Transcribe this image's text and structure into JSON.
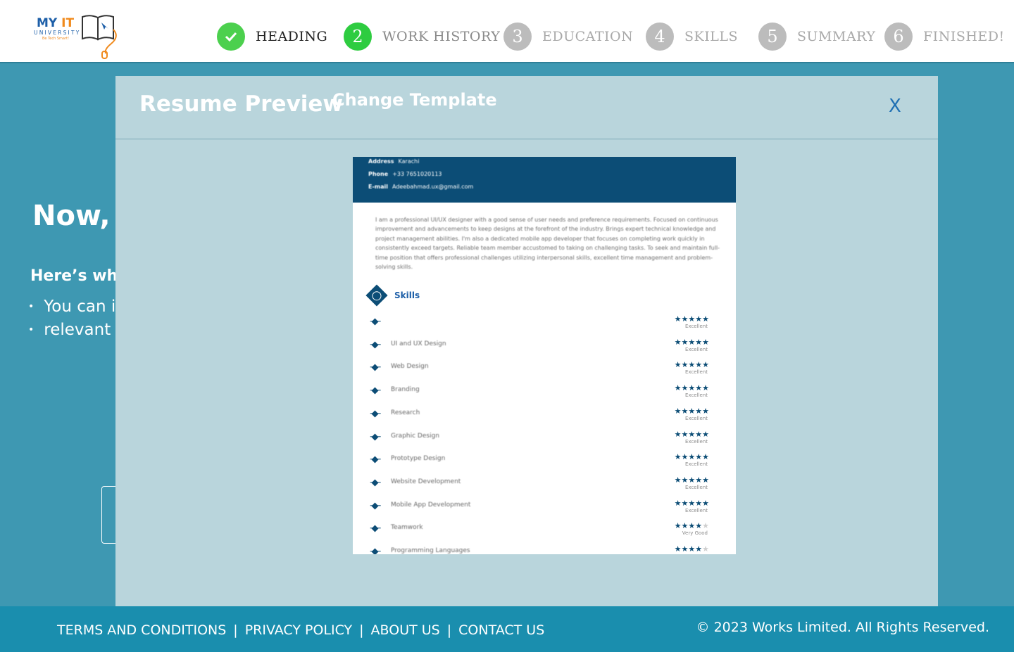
{
  "logo": {
    "line1": "MY",
    "line1b": "IT",
    "line2": "UNIVERSITY",
    "tagline": "Be Tech Smart!"
  },
  "steps": [
    {
      "num": "",
      "label": "HEADING",
      "state": "done"
    },
    {
      "num": "2",
      "label": "WORK HISTORY",
      "state": "active"
    },
    {
      "num": "3",
      "label": "EDUCATION",
      "state": "todo"
    },
    {
      "num": "4",
      "label": "SKILLS",
      "state": "todo"
    },
    {
      "num": "5",
      "label": "SUMMARY",
      "state": "todo"
    },
    {
      "num": "6",
      "label": "FINISHED!",
      "state": "todo"
    }
  ],
  "background": {
    "heading": "Now, l",
    "subheading": "Here’s wha",
    "bullets": [
      "You can i",
      "relevant e"
    ]
  },
  "modal": {
    "title": "Resume Preview",
    "change_template": "Change Template",
    "close": "X"
  },
  "resume": {
    "contact": [
      {
        "label": "Address",
        "value": "Karachi"
      },
      {
        "label": "Phone",
        "value": "+33 7651020113"
      },
      {
        "label": "E-mail",
        "value": "Adeebahmad.ux@gmail.com"
      }
    ],
    "summary": "I am a professional UI/UX designer with a good sense of user needs and preference requirements. Focused on continuous improvement and advancements to keep designs at the forefront of the industry. Brings expert technical knowledge and project management abilities. I'm also a dedicated mobile app developer that focuses on completing work quickly in consistently exceed targets. Reliable team member accustomed to taking on challenging tasks. To seek and maintain full-time position that offers professional challenges utilizing interpersonal skills, excellent time management and problem-solving skills.",
    "skills_title": "Skills",
    "skills": [
      {
        "name": "",
        "rating": 5,
        "level": "Excellent"
      },
      {
        "name": "UI and UX Design",
        "rating": 5,
        "level": "Excellent"
      },
      {
        "name": "Web Design",
        "rating": 5,
        "level": "Excellent"
      },
      {
        "name": "Branding",
        "rating": 5,
        "level": "Excellent"
      },
      {
        "name": "Research",
        "rating": 5,
        "level": "Excellent"
      },
      {
        "name": "Graphic Design",
        "rating": 5,
        "level": "Excellent"
      },
      {
        "name": "Prototype Design",
        "rating": 5,
        "level": "Excellent"
      },
      {
        "name": "Website Development",
        "rating": 5,
        "level": "Excellent"
      },
      {
        "name": "Mobile App Development",
        "rating": 5,
        "level": "Excellent"
      },
      {
        "name": "Teamwork",
        "rating": 4,
        "level": "Very Good"
      },
      {
        "name": "Programming Languages",
        "rating": 4,
        "level": ""
      }
    ]
  },
  "footer": {
    "links": [
      "TERMS AND CONDITIONS",
      "PRIVACY POLICY",
      "ABOUT US",
      "CONTACT US"
    ],
    "separator": "|",
    "copyright": "© 2023 Works Limited. All Rights Reserved."
  },
  "colors": {
    "primary_bg": "#3e98b2",
    "step_done": "#4cd04e",
    "step_active": "#2ecc40",
    "step_todo": "#bcbcbc",
    "resume_header": "#0c4d76",
    "footer": "#1a8eae"
  }
}
